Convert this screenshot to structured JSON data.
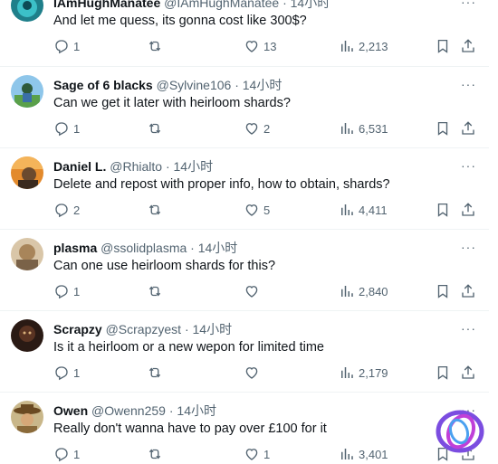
{
  "tweets": [
    {
      "name": "IAmHughManatee",
      "handle": "@IAmHughManatee",
      "time": "14小时",
      "text": "And let me quess, its gonna cost like 300$?",
      "replies": "1",
      "retweets": "",
      "likes": "13",
      "views": "2,213",
      "avatar": "teal-avatar"
    },
    {
      "name": "Sage of 6 blacks",
      "handle": "@Sylvine106",
      "time": "14小时",
      "text": "Can we get it later with heirloom shards?",
      "replies": "1",
      "retweets": "",
      "likes": "2",
      "views": "6,531",
      "avatar": "sky-avatar"
    },
    {
      "name": "Daniel L.",
      "handle": "@Rhialto",
      "time": "14小时",
      "text": "Delete and repost with proper info, how to obtain, shards?",
      "replies": "2",
      "retweets": "",
      "likes": "5",
      "views": "4,411",
      "avatar": "orange-avatar"
    },
    {
      "name": "plasma",
      "handle": "@ssolidplasma",
      "time": "14小时",
      "text": "Can one use heirloom shards for this?",
      "replies": "1",
      "retweets": "",
      "likes": "",
      "views": "2,840",
      "avatar": "tan-avatar"
    },
    {
      "name": "Scrapzy",
      "handle": "@Scrapzyest",
      "time": "14小时",
      "text": "Is it a heirloom or a new wepon for limited time",
      "replies": "1",
      "retweets": "",
      "likes": "",
      "views": "2,179",
      "avatar": "dark-avatar"
    },
    {
      "name": "Owen",
      "handle": "@Owenn259",
      "time": "14小时",
      "text": "Really don't wanna have to pay over £100 for it",
      "replies": "1",
      "retweets": "",
      "likes": "1",
      "views": "3,401",
      "avatar": "cowboy-avatar"
    }
  ],
  "dot": "·",
  "more": "···",
  "colors": {
    "muted": "#536471",
    "text": "#0f1419",
    "divider": "#eff3f4"
  }
}
